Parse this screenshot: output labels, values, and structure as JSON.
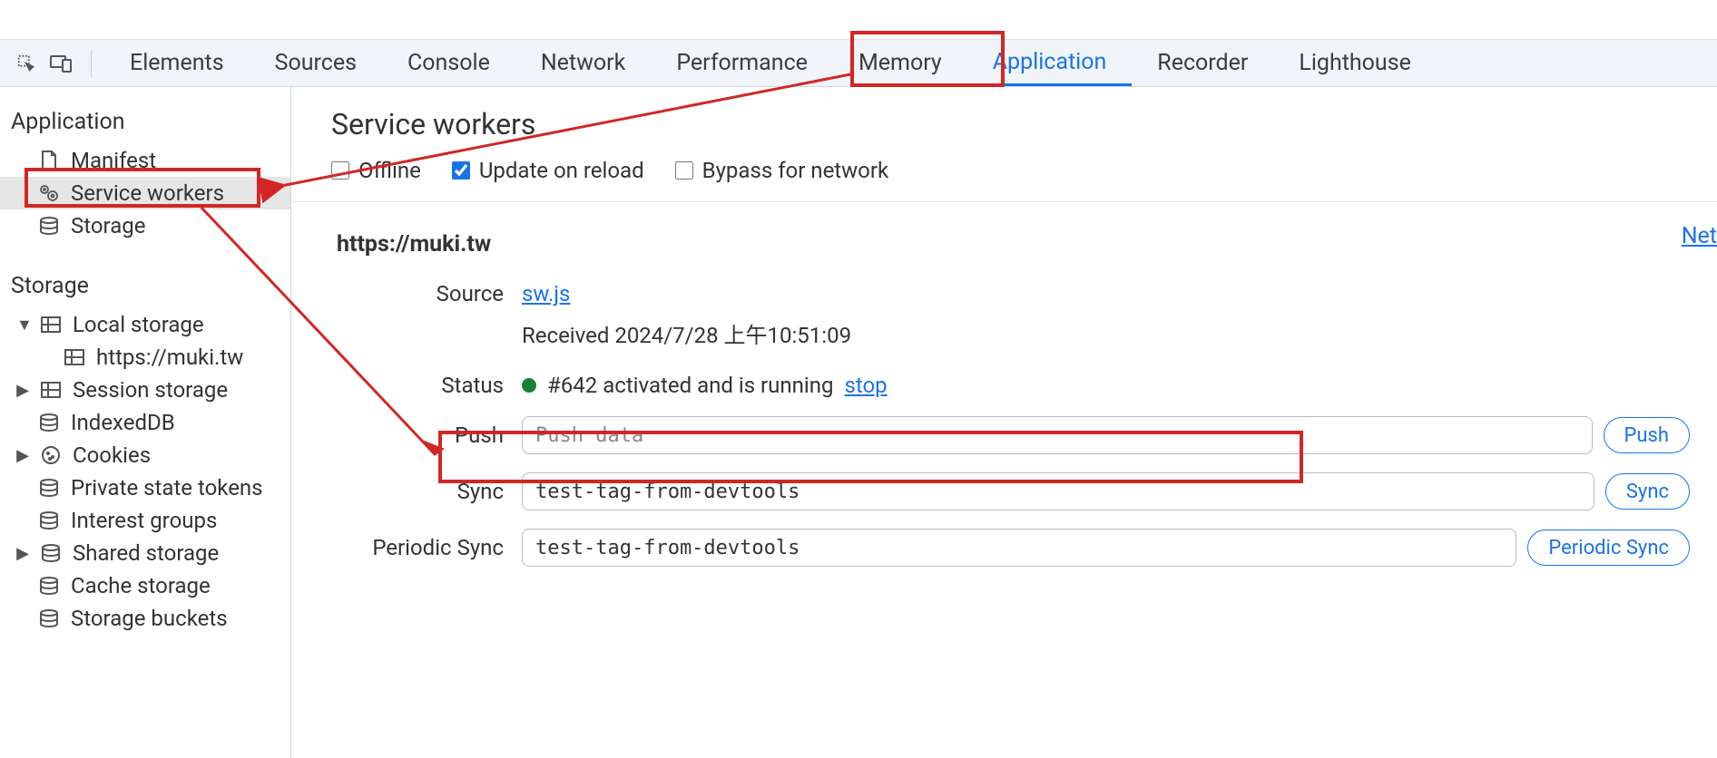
{
  "tabs": [
    "Elements",
    "Sources",
    "Console",
    "Network",
    "Performance",
    "Memory",
    "Application",
    "Recorder",
    "Lighthouse"
  ],
  "activeTab": "Application",
  "sidebar": {
    "section1": "Application",
    "items1": {
      "manifest": "Manifest",
      "sw": "Service workers",
      "storage": "Storage"
    },
    "section2": "Storage",
    "items2": {
      "local": "Local storage",
      "local_child": "https://muki.tw",
      "session": "Session storage",
      "idb": "IndexedDB",
      "cookies": "Cookies",
      "pst": "Private state tokens",
      "ig": "Interest groups",
      "shared": "Shared storage",
      "cache": "Cache storage",
      "buckets": "Storage buckets"
    }
  },
  "main": {
    "title": "Service workers",
    "checks": {
      "offline": "Offline",
      "update": "Update on reload",
      "bypass": "Bypass for network"
    },
    "origin": "https://muki.tw",
    "netlink": "Net",
    "labels": {
      "source": "Source",
      "status": "Status",
      "push": "Push",
      "sync": "Sync",
      "periodic": "Periodic Sync"
    },
    "source_link": "sw.js",
    "received": "Received 2024/7/28 上午10:51:09",
    "status_text": "#642 activated and is running",
    "stop": "stop",
    "push_placeholder": "Push data",
    "sync_value": "test-tag-from-devtools",
    "periodic_value": "test-tag-from-devtools",
    "btn": {
      "push": "Push",
      "sync": "Sync",
      "periodic": "Periodic Sync"
    }
  }
}
